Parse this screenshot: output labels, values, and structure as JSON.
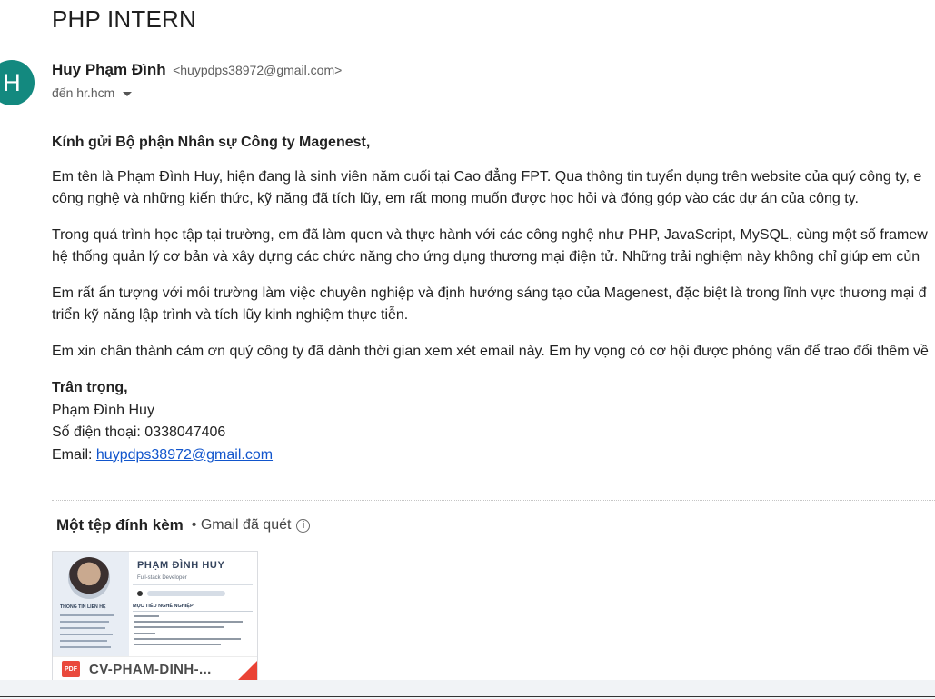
{
  "email": {
    "subject": "PHP INTERN",
    "sender": {
      "avatar_letter": "H",
      "avatar_color": "#13897f",
      "name": "Huy Phạm Đình",
      "email": "<huypdps38972@gmail.com>",
      "to": "đến hr.hcm"
    },
    "body": {
      "greeting": "Kính gửi Bộ phận Nhân sự Công ty Magenest,",
      "p1_line1": "Em tên là Phạm Đình Huy, hiện đang là sinh viên năm cuối tại Cao đẳng FPT. Qua thông tin tuyển dụng trên website của quý công ty, e",
      "p1_line2": "công nghệ và những kiến thức, kỹ năng đã tích lũy, em rất mong muốn được học hỏi và đóng góp vào các dự án của công ty.",
      "p2_line1": "Trong quá trình học tập tại trường, em đã làm quen và thực hành với các công nghệ như PHP, JavaScript, MySQL, cùng một số framew",
      "p2_line2": "hệ thống quản lý cơ bản và xây dựng các chức năng cho ứng dụng thương mại điện tử. Những trải nghiệm này không chỉ giúp em củn",
      "p3_line1": "Em rất ấn tượng với môi trường làm việc chuyên nghiệp và định hướng sáng tạo của Magenest, đặc biệt là trong lĩnh vực thương mại đ",
      "p3_line2": "triển kỹ năng lập trình và tích lũy kinh nghiệm thực tiễn.",
      "p4_line1": "Em xin chân thành cảm ơn quý công ty đã dành thời gian xem xét email này. Em hy vọng có cơ hội được phỏng vấn để trao đổi thêm về"
    },
    "signature": {
      "closing": "Trân trọng,",
      "name": "Phạm Đình Huy",
      "phone": "Số điện thoại: 0338047406",
      "email_label": "Email: ",
      "email_link": "huypdps38972@gmail.com"
    },
    "attachments": {
      "title": "Một tệp đính kèm",
      "scan_note": "• Gmail đã quét",
      "info_icon": "info-icon",
      "file": {
        "type_badge": "PDF",
        "name": "CV-PHAM-DINH-...",
        "preview": {
          "name": "PHẠM ĐÌNH HUY",
          "role": "Full-stack Developer",
          "left_section": "THÔNG TIN LIÊN HỆ",
          "right_section": "MỤC TIÊU NGHỀ NGHIỆP"
        }
      }
    }
  }
}
